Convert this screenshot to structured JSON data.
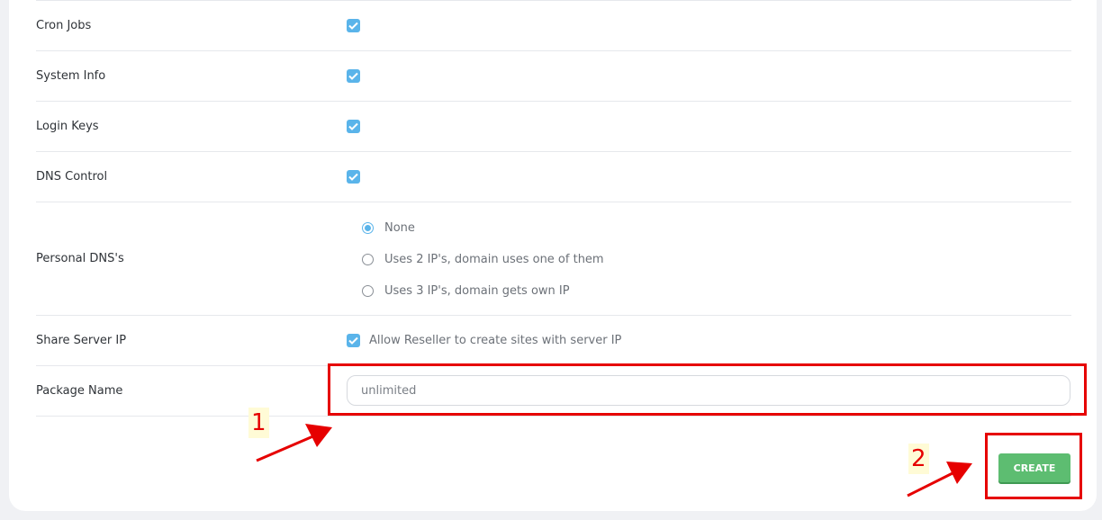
{
  "rows": [
    {
      "label": "Cron Jobs"
    },
    {
      "label": "System Info"
    },
    {
      "label": "Login Keys"
    },
    {
      "label": "DNS Control"
    }
  ],
  "personal_dns": {
    "label": "Personal DNS's",
    "options": [
      "None",
      "Uses 2 IP's, domain uses one of them",
      "Uses 3 IP's, domain gets own IP"
    ],
    "selected": "None"
  },
  "share_ip": {
    "label": "Share Server IP",
    "option_text": "Allow Reseller to create sites with server IP"
  },
  "package": {
    "label": "Package Name",
    "value": "unlimited"
  },
  "create_label": "CREATE",
  "annotations": {
    "step1": "1",
    "step2": "2",
    "color": "#e60000"
  },
  "colors": {
    "accent": "#5ab4ea",
    "create_button": "#5dbd71"
  }
}
